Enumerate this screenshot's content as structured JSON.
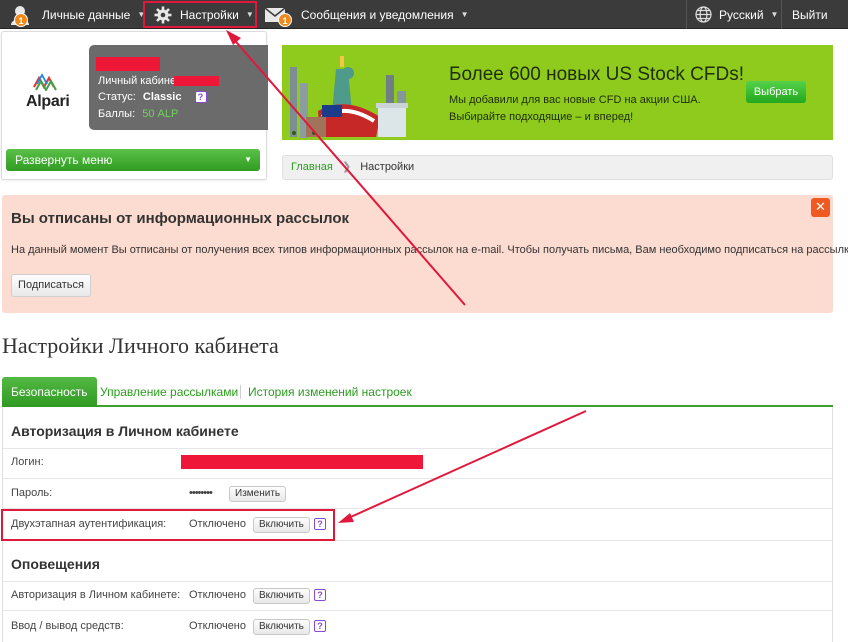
{
  "topbar": {
    "personal": "Личные данные",
    "personal_badge": "1",
    "settings": "Настройки",
    "messages": "Сообщения и уведомления",
    "messages_badge": "1",
    "language": "Русский",
    "logout": "Выйти"
  },
  "profile": {
    "logo": "Alpari",
    "cabinet_label": "Личный кабинет",
    "status_label": "Статус:",
    "status_value": "Classic",
    "points_label": "Баллы:",
    "points_value": "50 ALP",
    "help": "?",
    "expand_menu": "Развернуть меню"
  },
  "banner": {
    "title": "Более 600 новых US Stock CFDs!",
    "line1": "Мы добавили для вас новые CFD на акции США.",
    "line2": "Выбирайте подходящие – и вперед!",
    "button": "Выбрать"
  },
  "breadcrumb": {
    "home": "Главная",
    "current": "Настройки"
  },
  "alert": {
    "title": "Вы отписаны от информационных рассылок",
    "text": "На данный момент Вы отписаны от получения всех типов информационных рассылок на e-mail. Чтобы получать письма, Вам необходимо подписаться на рассылку.",
    "button": "Подписаться",
    "close": "✕"
  },
  "page": {
    "title": "Настройки Личного кабинета"
  },
  "tabs": [
    {
      "label": "Безопасность"
    },
    {
      "label": "Управление рассылками"
    },
    {
      "label": "История изменений настроек"
    }
  ],
  "auth_section": {
    "title": "Авторизация в Личном кабинете",
    "login_label": "Логин:",
    "password_label": "Пароль:",
    "password_value": "••••••••",
    "change_button": "Изменить",
    "twofa_label": "Двухэтапная аутентификация:",
    "twofa_value": "Отключено",
    "enable_button": "Включить"
  },
  "notify_section": {
    "title": "Оповещения",
    "rows": [
      {
        "label": "Авторизация в Личном кабинете:",
        "value": "Отключено",
        "button": "Включить"
      },
      {
        "label": "Ввод / вывод средств:",
        "value": "Отключено",
        "button": "Включить"
      }
    ]
  },
  "colors": {
    "accent_green": "#3aa12c",
    "highlight_red": "#e0193c",
    "alert_bg": "#fcdcd0",
    "banner_green": "#8fcb1c"
  }
}
